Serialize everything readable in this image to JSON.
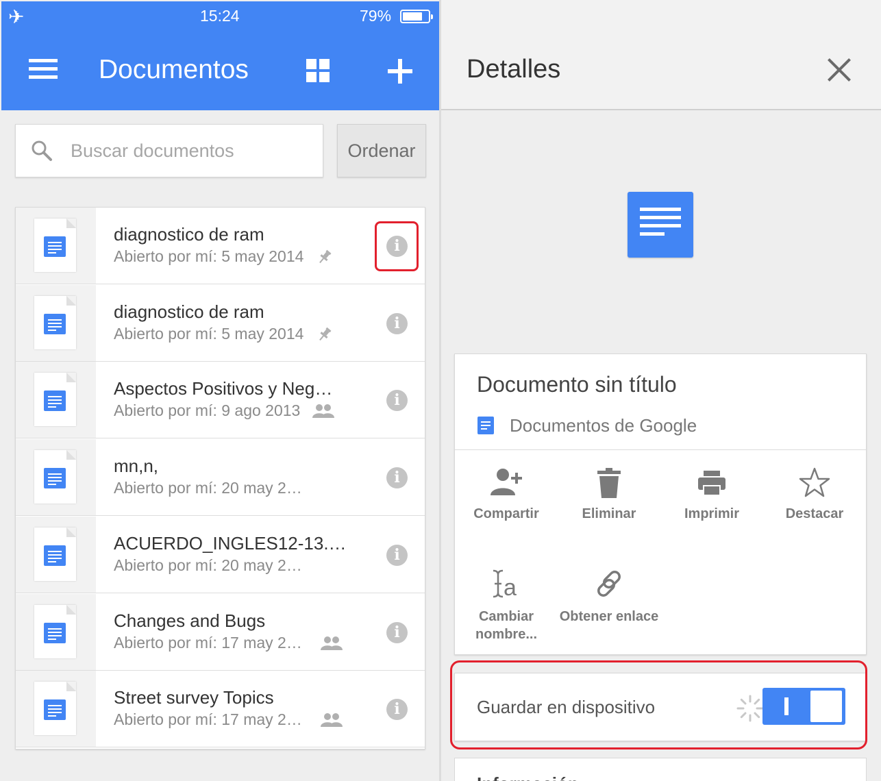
{
  "status_bar": {
    "time": "15:24",
    "battery": "79%",
    "battery_level": 0.79
  },
  "app_bar": {
    "title": "Documentos"
  },
  "search": {
    "placeholder": "Buscar documentos"
  },
  "sort": {
    "label": "Ordenar"
  },
  "documents": [
    {
      "name": "diagnostico de ram",
      "opened": "Abierto por mí: 5 may 2014",
      "tag": "pin-icon"
    },
    {
      "name": "diagnostico de ram",
      "opened": "Abierto por mí: 5 may 2014",
      "tag": "pin-icon"
    },
    {
      "name": "Aspectos Positivos y Neg…",
      "opened": "Abierto por mí: 9 ago 2013",
      "tag": "people-icon"
    },
    {
      "name": "mn,n,",
      "opened": "Abierto por mí: 20 may 2…",
      "tag": ""
    },
    {
      "name": "ACUERDO_INGLES12-13.…",
      "opened": "Abierto por mí: 20 may 2…",
      "tag": ""
    },
    {
      "name": "Changes and Bugs",
      "opened": "Abierto por mí: 17 may 2…",
      "tag": "people-icon"
    },
    {
      "name": "Street survey Topics",
      "opened": "Abierto por mí: 17 may 2…",
      "tag": "people-icon"
    }
  ],
  "details": {
    "title": "Detalles",
    "doc_title": "Documento sin título",
    "doc_type": "Documentos de Google",
    "actions": [
      {
        "label": "Compartir",
        "icon": "add-person-icon"
      },
      {
        "label": "Eliminar",
        "icon": "trash-icon"
      },
      {
        "label": "Imprimir",
        "icon": "print-icon"
      },
      {
        "label": "Destacar",
        "icon": "star-icon"
      },
      {
        "label": "Cambiar nombre...",
        "icon": "rename-icon"
      },
      {
        "label": "Obtener enlace",
        "icon": "link-icon"
      }
    ],
    "save_on_device": {
      "label": "Guardar en dispositivo",
      "enabled": true
    },
    "next_section": "Información"
  },
  "colors": {
    "accent": "#4285f4",
    "highlight": "#e2202d",
    "background": "#eeeeee"
  }
}
